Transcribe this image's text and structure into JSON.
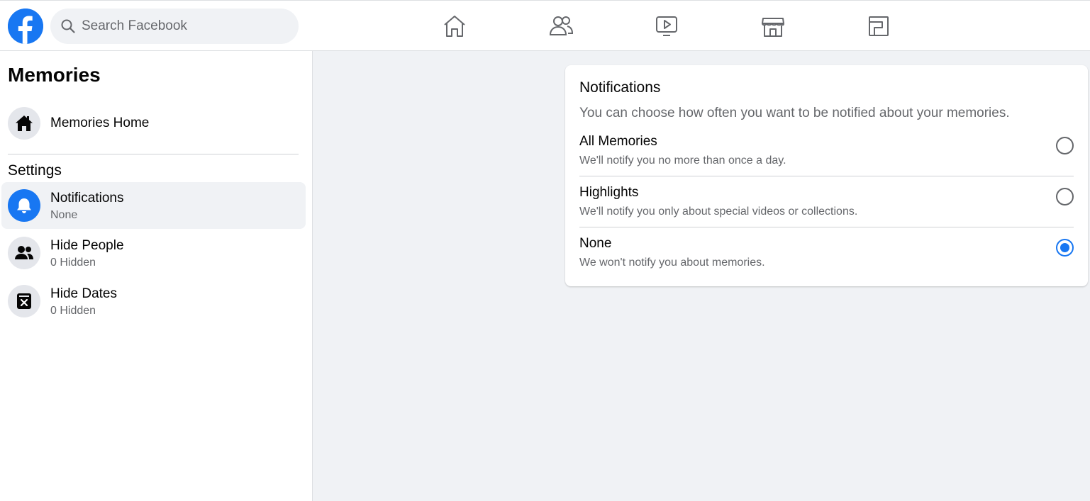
{
  "header": {
    "logo_icon": "facebook-logo",
    "search_placeholder": "Search Facebook",
    "nav_icons": [
      "home-icon",
      "friends-icon",
      "watch-icon",
      "marketplace-icon",
      "gaming-icon"
    ]
  },
  "sidebar": {
    "title": "Memories",
    "home": {
      "label": "Memories Home",
      "icon": "home-filled-icon"
    },
    "settings_label": "Settings",
    "items": [
      {
        "label": "Notifications",
        "sub": "None",
        "icon": "bell-icon"
      },
      {
        "label": "Hide People",
        "sub": "0 Hidden",
        "icon": "people-icon"
      },
      {
        "label": "Hide Dates",
        "sub": "0 Hidden",
        "icon": "calendar-x-icon"
      }
    ]
  },
  "card": {
    "title": "Notifications",
    "description": "You can choose how often you want to be notified about your memories.",
    "options": [
      {
        "label": "All Memories",
        "sub": "We'll notify you no more than once a day.",
        "selected": false
      },
      {
        "label": "Highlights",
        "sub": "We'll notify you only about special videos or collections.",
        "selected": false
      },
      {
        "label": "None",
        "sub": "We won't notify you about memories.",
        "selected": true
      }
    ]
  },
  "colors": {
    "brand": "#1877f2",
    "background": "#f0f2f5",
    "secondary_text": "#65676b"
  }
}
